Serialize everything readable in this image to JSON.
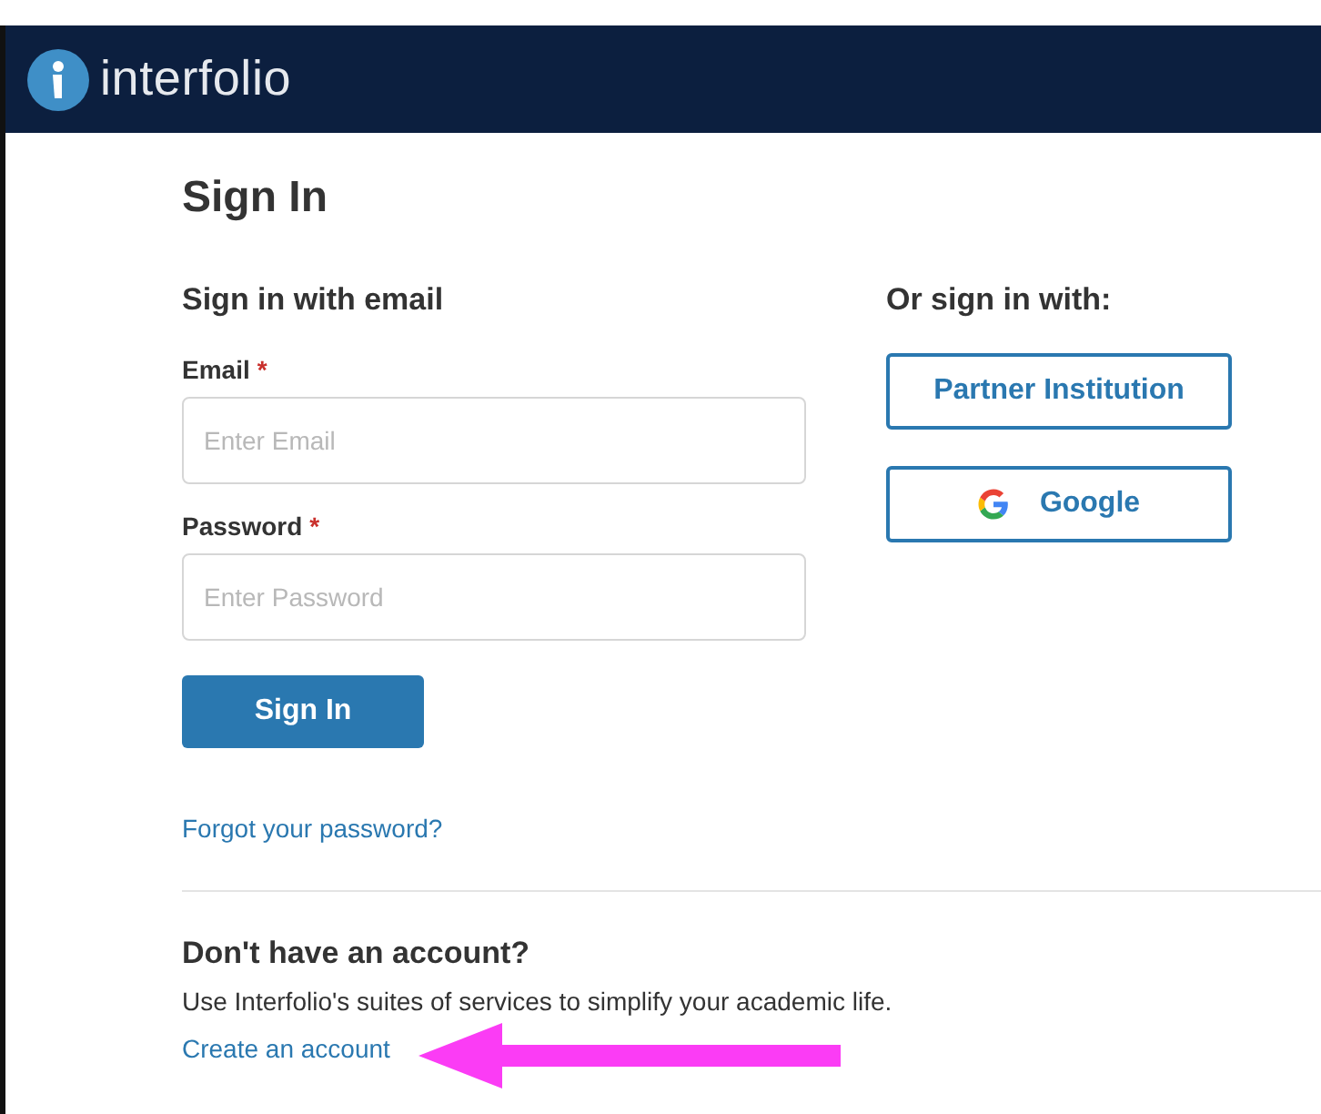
{
  "header": {
    "brand": "interfolio"
  },
  "title": "Sign In",
  "email_section": {
    "heading": "Sign in with email",
    "fields": [
      {
        "label": "Email",
        "required_mark": "*",
        "placeholder": "Enter Email"
      },
      {
        "label": "Password",
        "required_mark": "*",
        "placeholder": "Enter Password"
      }
    ],
    "submit": "Sign In",
    "forgot_link": "Forgot your password?"
  },
  "alt_section": {
    "heading": "Or sign in with:",
    "buttons": [
      {
        "label": "Partner Institution",
        "kind": "plain"
      },
      {
        "label": "Google",
        "kind": "google"
      }
    ]
  },
  "signup": {
    "heading": "Don't have an account?",
    "text": "Use Interfolio's suites of services to simplify your academic life.",
    "link": "Create an account"
  }
}
